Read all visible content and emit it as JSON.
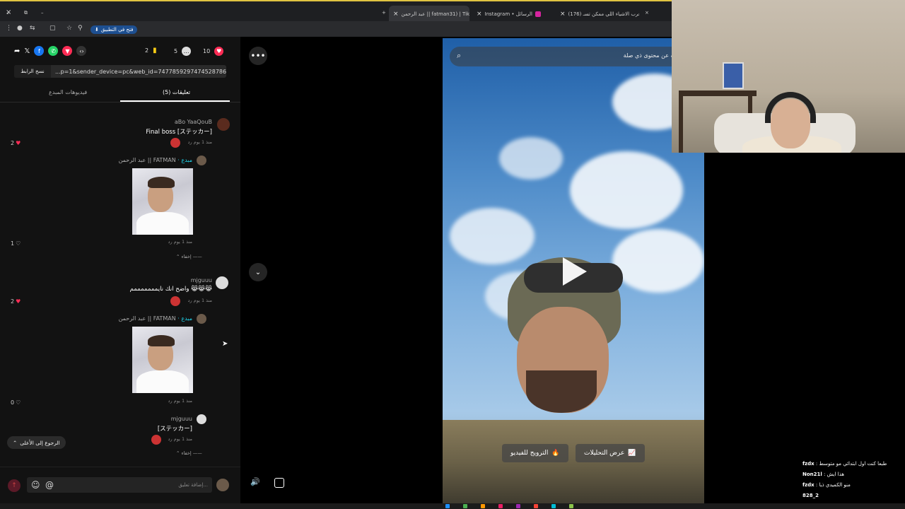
{
  "browser": {
    "tabs": [
      {
        "title": "عبد الرحمن || fatman31) | TikTok",
        "active": true
      },
      {
        "title": "Instagram • الرسائل",
        "active": false
      },
      {
        "title": "(176) اغرب الاشياء اللي ممكن تسـ",
        "active": false
      }
    ],
    "open_in_app": "فتح في التطبيق"
  },
  "panel": {
    "stats": {
      "saves": "2",
      "comments": "5",
      "likes": "10"
    },
    "link": {
      "copy_label": "نسخ الرابط",
      "url": "...p=1&sender_device=pc&web_id=7477859297474528786"
    },
    "tabs": {
      "comments": "تعليقات (5)",
      "creator_videos": "فيديوهات المبدع"
    },
    "comments": [
      {
        "user": "aBo YaaQouB",
        "text": "Final boss [ステッカー]",
        "meta": "منذ 1 يوم   رد",
        "likes": "2",
        "liked": true
      },
      {
        "user": "عبد الرحمن || FATMAN",
        "tag": "· مبدع",
        "meta": "منذ 1 يوم   رد",
        "likes": "1",
        "liked": false,
        "hide": "إخفاء"
      },
      {
        "user": "mjguuu",
        "text": "واضح انك نايمممممممم 😹😹😹",
        "meta": "منذ 1 يوم   رد",
        "likes": "2",
        "liked": true
      },
      {
        "user": "عبد الرحمن || FATMAN",
        "tag": "· مبدع",
        "meta": "منذ 1 يوم   رد",
        "likes": "0",
        "liked": false
      },
      {
        "user": "mjguuu",
        "text": "[ステッカー]",
        "meta": "منذ 1 يوم   رد",
        "hide": "إخفاء"
      }
    ],
    "back_to_top": "الرجوع إلى الأعلى",
    "comment_placeholder": "إضافة تعليق..."
  },
  "video": {
    "search_placeholder": "ابحث عن محتوى ذي صلة",
    "promote": "الترويج للفيديو",
    "analytics": "عرض التحليلات"
  },
  "chat": [
    {
      "user": "fzdx",
      "text": "طبعا كنت اول ابتدائي مو متوسط"
    },
    {
      "user": "Non21l",
      "text": "هذا ايش"
    },
    {
      "user": "fzdx",
      "text": "منو الكميدي ذيا"
    },
    {
      "user": "828_2",
      "text": ""
    }
  ],
  "colors": {
    "accent_red": "#fe2c55",
    "creator_teal": "#20d5ec",
    "link_blue": "#1d4f91"
  }
}
